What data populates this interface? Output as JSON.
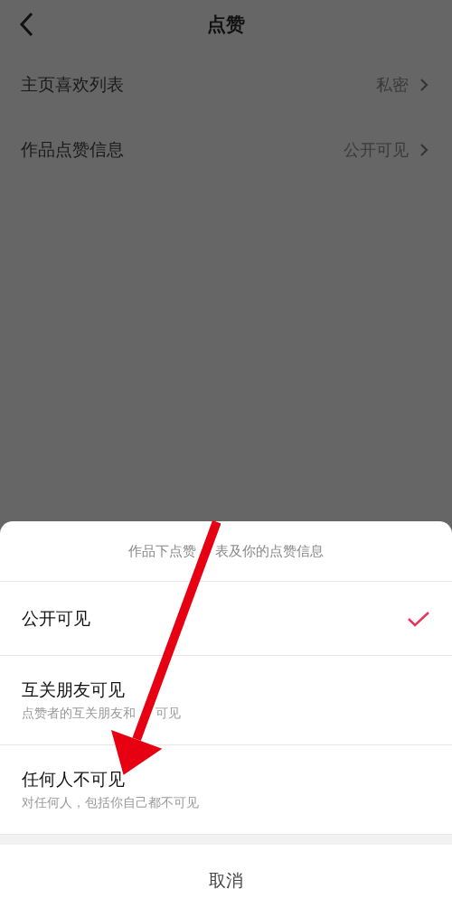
{
  "header": {
    "title": "点赞"
  },
  "settings": [
    {
      "label": "主页喜欢列表",
      "value": "私密"
    },
    {
      "label": "作品点赞信息",
      "value": "公开可见"
    }
  ],
  "sheet": {
    "title": [
      "作品下点赞",
      "表及你的点赞信息"
    ],
    "options": [
      {
        "label": "公开可见",
        "selected": true
      },
      {
        "label": "互关朋友可见",
        "description": [
          "点赞者的互关朋友和",
          "可见"
        ],
        "selected": false
      },
      {
        "label": "任何人不可见",
        "description": [
          "对任何人，包括你自己都不可见"
        ],
        "selected": false
      }
    ],
    "cancel": "取消"
  }
}
